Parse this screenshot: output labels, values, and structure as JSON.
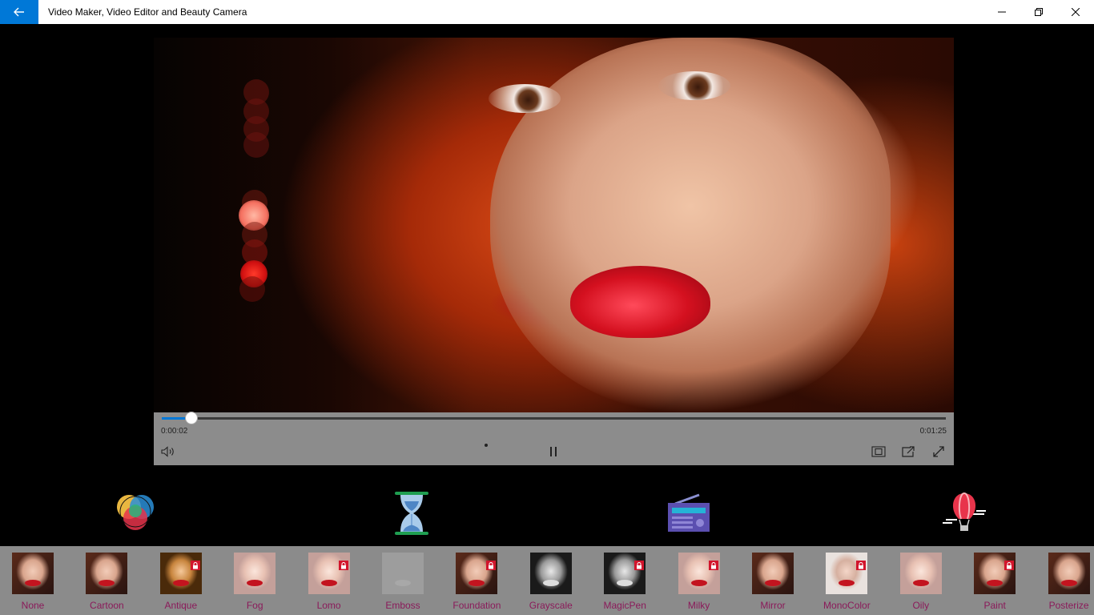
{
  "window": {
    "title": "Video Maker, Video Editor and Beauty Camera"
  },
  "player": {
    "current_time": "0:00:02",
    "total_time": "0:01:25",
    "progress": 0.038
  },
  "tools": [
    "color-filter-icon",
    "hourglass-icon",
    "radio-icon",
    "hot-air-balloon-icon"
  ],
  "filters": [
    {
      "label": "None",
      "locked": false,
      "style": ""
    },
    {
      "label": "Cartoon",
      "locked": false,
      "style": ""
    },
    {
      "label": "Antique",
      "locked": true,
      "style": "sepia"
    },
    {
      "label": "Fog",
      "locked": false,
      "style": "light"
    },
    {
      "label": "Lomo",
      "locked": true,
      "style": "light"
    },
    {
      "label": "Emboss",
      "locked": false,
      "style": "emboss"
    },
    {
      "label": "Foundation",
      "locked": true,
      "style": ""
    },
    {
      "label": "Grayscale",
      "locked": false,
      "style": "gray"
    },
    {
      "label": "MagicPen",
      "locked": true,
      "style": "gray"
    },
    {
      "label": "Milky",
      "locked": true,
      "style": "light"
    },
    {
      "label": "Mirror",
      "locked": false,
      "style": ""
    },
    {
      "label": "MonoColor",
      "locked": true,
      "style": "mono"
    },
    {
      "label": "Oily",
      "locked": false,
      "style": "light"
    },
    {
      "label": "Paint",
      "locked": true,
      "style": ""
    },
    {
      "label": "Posterize",
      "locked": false,
      "style": ""
    }
  ],
  "colors": {
    "accent": "#0078d7",
    "controls_bg": "#8c8c8c",
    "filter_label": "#8b1a5a",
    "lock_badge": "#d2152c"
  }
}
